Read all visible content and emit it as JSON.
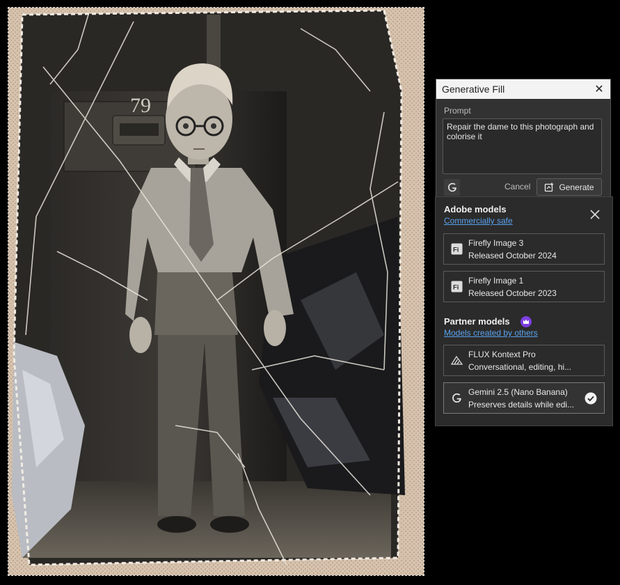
{
  "photo": {
    "door_number": "79"
  },
  "generative_fill": {
    "title": "Generative Fill",
    "prompt_label": "Prompt",
    "prompt_text": "Repair the dame to this photograph and colorise it",
    "cancel_label": "Cancel",
    "generate_label": "Generate"
  },
  "model_picker": {
    "adobe_section": {
      "title": "Adobe models",
      "subtitle_link": "Commercially safe",
      "models": [
        {
          "name": "Firefly Image 3",
          "description": "Released October 2024",
          "icon": "firefly-icon",
          "selected": false
        },
        {
          "name": "Firefly Image 1",
          "description": "Released October 2023",
          "icon": "firefly-icon",
          "selected": false
        }
      ]
    },
    "partner_section": {
      "title": "Partner models",
      "subtitle_link": "Models created by others",
      "badge_icon": "crown-icon",
      "models": [
        {
          "name": "FLUX Kontext Pro",
          "description": "Conversational, editing, hi...",
          "icon": "flux-icon",
          "selected": false
        },
        {
          "name": "Gemini 2.5 (Nano Banana)",
          "description": "Preserves details while edi...",
          "icon": "google-g-icon",
          "selected": true
        }
      ]
    }
  },
  "colors": {
    "panel_bg": "#323232",
    "flyout_bg": "#2b2b2b",
    "link": "#5aa2ee",
    "crown_badge": "#7b3fe0"
  }
}
